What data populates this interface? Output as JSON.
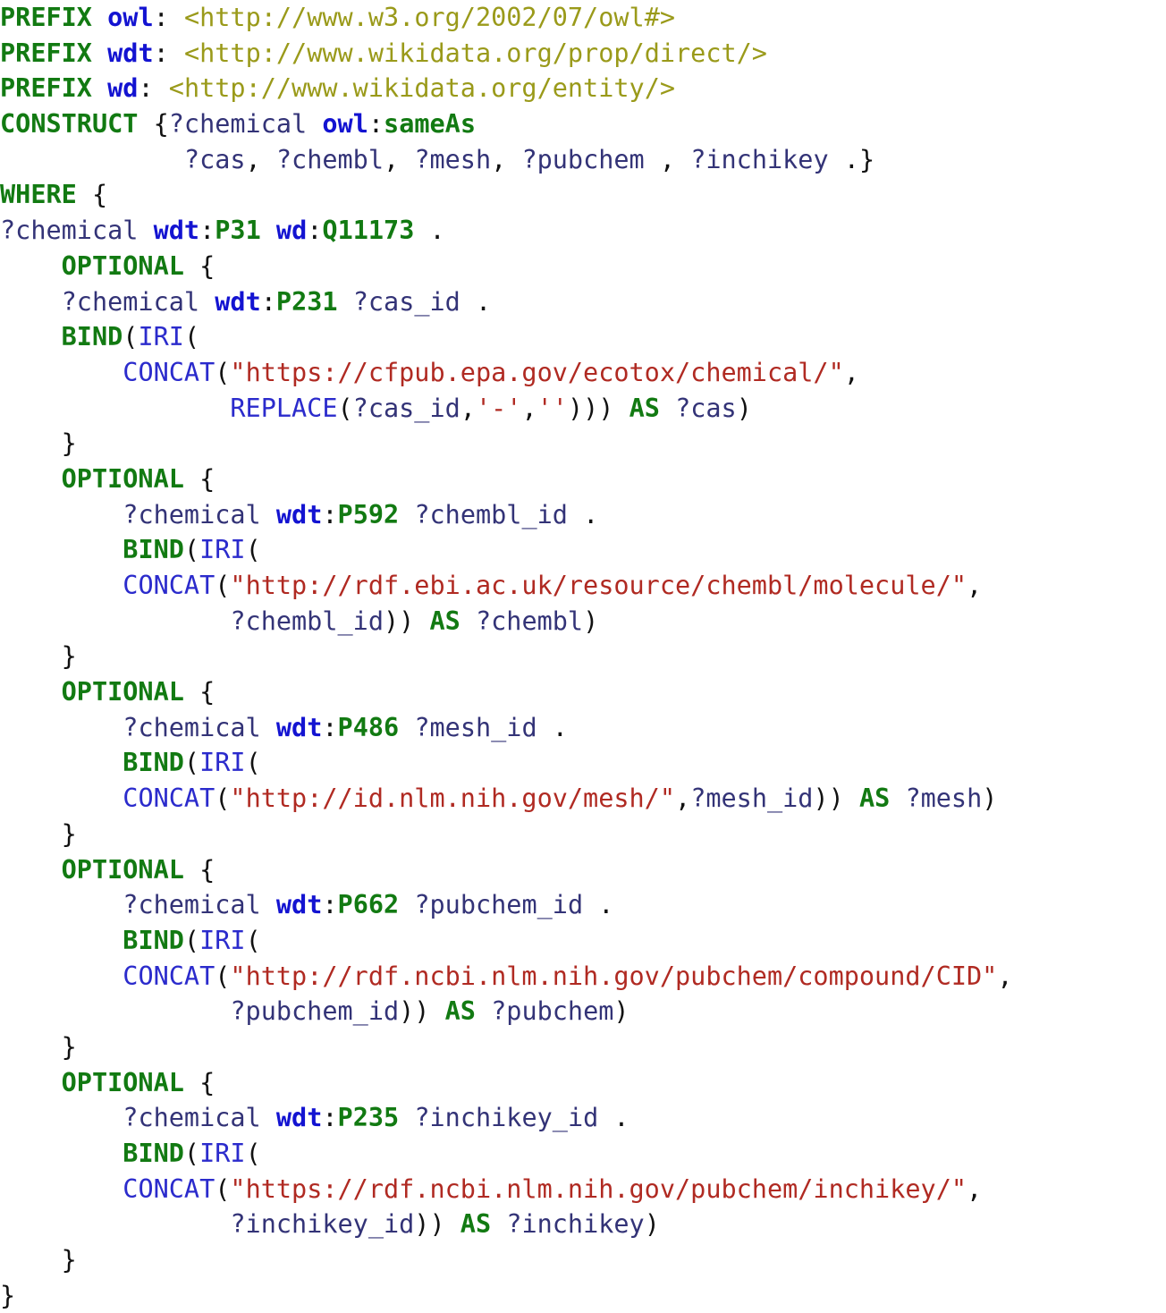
{
  "document": {
    "kind": "sparql-query-listing",
    "language": "SPARQL",
    "background_color": "#ffffff"
  },
  "palette": {
    "keyword": "#127a12",
    "prefix": "#1313d1",
    "localname": "#127a12",
    "iri": "#9a9a1a",
    "variable": "#333377",
    "function": "#2b2bcc",
    "string": "#b02a22",
    "punctuation": "#111111"
  },
  "code": {
    "lines": [
      {
        "id": "l1",
        "indent": 0,
        "tokens": [
          {
            "t": "PREFIX",
            "c": "kw"
          },
          {
            "t": " ",
            "c": "pun"
          },
          {
            "t": "owl",
            "c": "pfx"
          },
          {
            "t": ": ",
            "c": "pun"
          },
          {
            "t": "<http://www.w3.org/2002/07/owl#>",
            "c": "iri"
          }
        ]
      },
      {
        "id": "l2",
        "indent": 0,
        "tokens": [
          {
            "t": "PREFIX",
            "c": "kw"
          },
          {
            "t": " ",
            "c": "pun"
          },
          {
            "t": "wdt",
            "c": "pfx"
          },
          {
            "t": ": ",
            "c": "pun"
          },
          {
            "t": "<http://www.wikidata.org/prop/direct/>",
            "c": "iri"
          }
        ]
      },
      {
        "id": "l3",
        "indent": 0,
        "tokens": [
          {
            "t": "PREFIX",
            "c": "kw"
          },
          {
            "t": " ",
            "c": "pun"
          },
          {
            "t": "wd",
            "c": "pfx"
          },
          {
            "t": ": ",
            "c": "pun"
          },
          {
            "t": "<http://www.wikidata.org/entity/>",
            "c": "iri"
          }
        ]
      },
      {
        "id": "l4",
        "indent": 0,
        "tokens": [
          {
            "t": "CONSTRUCT",
            "c": "kw"
          },
          {
            "t": " {",
            "c": "pun"
          },
          {
            "t": "?chemical",
            "c": "var"
          },
          {
            "t": " ",
            "c": "pun"
          },
          {
            "t": "owl",
            "c": "pfx"
          },
          {
            "t": ":",
            "c": "pun"
          },
          {
            "t": "sameAs",
            "c": "loc"
          }
        ]
      },
      {
        "id": "l5",
        "indent": 12,
        "tokens": [
          {
            "t": "?cas",
            "c": "var"
          },
          {
            "t": ", ",
            "c": "pun"
          },
          {
            "t": "?chembl",
            "c": "var"
          },
          {
            "t": ", ",
            "c": "pun"
          },
          {
            "t": "?mesh",
            "c": "var"
          },
          {
            "t": ", ",
            "c": "pun"
          },
          {
            "t": "?pubchem",
            "c": "var"
          },
          {
            "t": " , ",
            "c": "pun"
          },
          {
            "t": "?inchikey",
            "c": "var"
          },
          {
            "t": " .}",
            "c": "pun"
          }
        ]
      },
      {
        "id": "l6",
        "indent": 0,
        "tokens": [
          {
            "t": "WHERE",
            "c": "kw"
          },
          {
            "t": " {",
            "c": "pun"
          }
        ]
      },
      {
        "id": "l7",
        "indent": 0,
        "tokens": [
          {
            "t": "?chemical",
            "c": "var"
          },
          {
            "t": " ",
            "c": "pun"
          },
          {
            "t": "wdt",
            "c": "pfx"
          },
          {
            "t": ":",
            "c": "pun"
          },
          {
            "t": "P31",
            "c": "loc"
          },
          {
            "t": " ",
            "c": "pun"
          },
          {
            "t": "wd",
            "c": "pfx"
          },
          {
            "t": ":",
            "c": "pun"
          },
          {
            "t": "Q11173",
            "c": "loc"
          },
          {
            "t": " .",
            "c": "pun"
          }
        ]
      },
      {
        "id": "l8",
        "indent": 4,
        "tokens": [
          {
            "t": "OPTIONAL",
            "c": "kw"
          },
          {
            "t": " {",
            "c": "pun"
          }
        ]
      },
      {
        "id": "l9",
        "indent": 4,
        "tokens": [
          {
            "t": "?chemical",
            "c": "var"
          },
          {
            "t": " ",
            "c": "pun"
          },
          {
            "t": "wdt",
            "c": "pfx"
          },
          {
            "t": ":",
            "c": "pun"
          },
          {
            "t": "P231",
            "c": "loc"
          },
          {
            "t": " ",
            "c": "pun"
          },
          {
            "t": "?cas_id",
            "c": "var"
          },
          {
            "t": " .",
            "c": "pun"
          }
        ]
      },
      {
        "id": "l10",
        "indent": 4,
        "tokens": [
          {
            "t": "BIND",
            "c": "kw"
          },
          {
            "t": "(",
            "c": "pun"
          },
          {
            "t": "IRI",
            "c": "fn"
          },
          {
            "t": "(",
            "c": "pun"
          }
        ]
      },
      {
        "id": "l11",
        "indent": 8,
        "tokens": [
          {
            "t": "CONCAT",
            "c": "fn"
          },
          {
            "t": "(",
            "c": "pun"
          },
          {
            "t": "\"https://cfpub.epa.gov/ecotox/chemical/\"",
            "c": "str"
          },
          {
            "t": ",",
            "c": "pun"
          }
        ]
      },
      {
        "id": "l12",
        "indent": 15,
        "tokens": [
          {
            "t": "REPLACE",
            "c": "fn"
          },
          {
            "t": "(",
            "c": "pun"
          },
          {
            "t": "?cas_id",
            "c": "var"
          },
          {
            "t": ",",
            "c": "pun"
          },
          {
            "t": "'-'",
            "c": "str"
          },
          {
            "t": ",",
            "c": "pun"
          },
          {
            "t": "''",
            "c": "str"
          },
          {
            "t": "))) ",
            "c": "pun"
          },
          {
            "t": "AS",
            "c": "kw"
          },
          {
            "t": " ",
            "c": "pun"
          },
          {
            "t": "?cas",
            "c": "var"
          },
          {
            "t": ")",
            "c": "pun"
          }
        ]
      },
      {
        "id": "l13",
        "indent": 4,
        "tokens": [
          {
            "t": "}",
            "c": "pun"
          }
        ]
      },
      {
        "id": "l14",
        "indent": 4,
        "tokens": [
          {
            "t": "OPTIONAL",
            "c": "kw"
          },
          {
            "t": " {",
            "c": "pun"
          }
        ]
      },
      {
        "id": "l15",
        "indent": 8,
        "tokens": [
          {
            "t": "?chemical",
            "c": "var"
          },
          {
            "t": " ",
            "c": "pun"
          },
          {
            "t": "wdt",
            "c": "pfx"
          },
          {
            "t": ":",
            "c": "pun"
          },
          {
            "t": "P592",
            "c": "loc"
          },
          {
            "t": " ",
            "c": "pun"
          },
          {
            "t": "?chembl_id",
            "c": "var"
          },
          {
            "t": " .",
            "c": "pun"
          }
        ]
      },
      {
        "id": "l16",
        "indent": 8,
        "tokens": [
          {
            "t": "BIND",
            "c": "kw"
          },
          {
            "t": "(",
            "c": "pun"
          },
          {
            "t": "IRI",
            "c": "fn"
          },
          {
            "t": "(",
            "c": "pun"
          }
        ]
      },
      {
        "id": "l17",
        "indent": 8,
        "tokens": [
          {
            "t": "CONCAT",
            "c": "fn"
          },
          {
            "t": "(",
            "c": "pun"
          },
          {
            "t": "\"http://rdf.ebi.ac.uk/resource/chembl/molecule/\"",
            "c": "str"
          },
          {
            "t": ",",
            "c": "pun"
          }
        ]
      },
      {
        "id": "l18",
        "indent": 15,
        "tokens": [
          {
            "t": "?chembl_id",
            "c": "var"
          },
          {
            "t": ")) ",
            "c": "pun"
          },
          {
            "t": "AS",
            "c": "kw"
          },
          {
            "t": " ",
            "c": "pun"
          },
          {
            "t": "?chembl",
            "c": "var"
          },
          {
            "t": ")",
            "c": "pun"
          }
        ]
      },
      {
        "id": "l19",
        "indent": 4,
        "tokens": [
          {
            "t": "}",
            "c": "pun"
          }
        ]
      },
      {
        "id": "l20",
        "indent": 4,
        "tokens": [
          {
            "t": "OPTIONAL",
            "c": "kw"
          },
          {
            "t": " {",
            "c": "pun"
          }
        ]
      },
      {
        "id": "l21",
        "indent": 8,
        "tokens": [
          {
            "t": "?chemical",
            "c": "var"
          },
          {
            "t": " ",
            "c": "pun"
          },
          {
            "t": "wdt",
            "c": "pfx"
          },
          {
            "t": ":",
            "c": "pun"
          },
          {
            "t": "P486",
            "c": "loc"
          },
          {
            "t": " ",
            "c": "pun"
          },
          {
            "t": "?mesh_id",
            "c": "var"
          },
          {
            "t": " .",
            "c": "pun"
          }
        ]
      },
      {
        "id": "l22",
        "indent": 8,
        "tokens": [
          {
            "t": "BIND",
            "c": "kw"
          },
          {
            "t": "(",
            "c": "pun"
          },
          {
            "t": "IRI",
            "c": "fn"
          },
          {
            "t": "(",
            "c": "pun"
          }
        ]
      },
      {
        "id": "l23",
        "indent": 8,
        "tokens": [
          {
            "t": "CONCAT",
            "c": "fn"
          },
          {
            "t": "(",
            "c": "pun"
          },
          {
            "t": "\"http://id.nlm.nih.gov/mesh/\"",
            "c": "str"
          },
          {
            "t": ",",
            "c": "pun"
          },
          {
            "t": "?mesh_id",
            "c": "var"
          },
          {
            "t": ")) ",
            "c": "pun"
          },
          {
            "t": "AS",
            "c": "kw"
          },
          {
            "t": " ",
            "c": "pun"
          },
          {
            "t": "?mesh",
            "c": "var"
          },
          {
            "t": ")",
            "c": "pun"
          }
        ]
      },
      {
        "id": "l24",
        "indent": 4,
        "tokens": [
          {
            "t": "}",
            "c": "pun"
          }
        ]
      },
      {
        "id": "l25",
        "indent": 4,
        "tokens": [
          {
            "t": "OPTIONAL",
            "c": "kw"
          },
          {
            "t": " {",
            "c": "pun"
          }
        ]
      },
      {
        "id": "l26",
        "indent": 8,
        "tokens": [
          {
            "t": "?chemical",
            "c": "var"
          },
          {
            "t": " ",
            "c": "pun"
          },
          {
            "t": "wdt",
            "c": "pfx"
          },
          {
            "t": ":",
            "c": "pun"
          },
          {
            "t": "P662",
            "c": "loc"
          },
          {
            "t": " ",
            "c": "pun"
          },
          {
            "t": "?pubchem_id",
            "c": "var"
          },
          {
            "t": " .",
            "c": "pun"
          }
        ]
      },
      {
        "id": "l27",
        "indent": 8,
        "tokens": [
          {
            "t": "BIND",
            "c": "kw"
          },
          {
            "t": "(",
            "c": "pun"
          },
          {
            "t": "IRI",
            "c": "fn"
          },
          {
            "t": "(",
            "c": "pun"
          }
        ]
      },
      {
        "id": "l28",
        "indent": 8,
        "tokens": [
          {
            "t": "CONCAT",
            "c": "fn"
          },
          {
            "t": "(",
            "c": "pun"
          },
          {
            "t": "\"http://rdf.ncbi.nlm.nih.gov/pubchem/compound/CID\"",
            "c": "str"
          },
          {
            "t": ",",
            "c": "pun"
          }
        ]
      },
      {
        "id": "l29",
        "indent": 15,
        "tokens": [
          {
            "t": "?pubchem_id",
            "c": "var"
          },
          {
            "t": ")) ",
            "c": "pun"
          },
          {
            "t": "AS",
            "c": "kw"
          },
          {
            "t": " ",
            "c": "pun"
          },
          {
            "t": "?pubchem",
            "c": "var"
          },
          {
            "t": ")",
            "c": "pun"
          }
        ]
      },
      {
        "id": "l30",
        "indent": 4,
        "tokens": [
          {
            "t": "}",
            "c": "pun"
          }
        ]
      },
      {
        "id": "l31",
        "indent": 4,
        "tokens": [
          {
            "t": "OPTIONAL",
            "c": "kw"
          },
          {
            "t": " {",
            "c": "pun"
          }
        ]
      },
      {
        "id": "l32",
        "indent": 8,
        "tokens": [
          {
            "t": "?chemical",
            "c": "var"
          },
          {
            "t": " ",
            "c": "pun"
          },
          {
            "t": "wdt",
            "c": "pfx"
          },
          {
            "t": ":",
            "c": "pun"
          },
          {
            "t": "P235",
            "c": "loc"
          },
          {
            "t": " ",
            "c": "pun"
          },
          {
            "t": "?inchikey_id",
            "c": "var"
          },
          {
            "t": " .",
            "c": "pun"
          }
        ]
      },
      {
        "id": "l33",
        "indent": 8,
        "tokens": [
          {
            "t": "BIND",
            "c": "kw"
          },
          {
            "t": "(",
            "c": "pun"
          },
          {
            "t": "IRI",
            "c": "fn"
          },
          {
            "t": "(",
            "c": "pun"
          }
        ]
      },
      {
        "id": "l34",
        "indent": 8,
        "tokens": [
          {
            "t": "CONCAT",
            "c": "fn"
          },
          {
            "t": "(",
            "c": "pun"
          },
          {
            "t": "\"https://rdf.ncbi.nlm.nih.gov/pubchem/inchikey/\"",
            "c": "str"
          },
          {
            "t": ",",
            "c": "pun"
          }
        ]
      },
      {
        "id": "l35",
        "indent": 15,
        "tokens": [
          {
            "t": "?inchikey_id",
            "c": "var"
          },
          {
            "t": ")) ",
            "c": "pun"
          },
          {
            "t": "AS",
            "c": "kw"
          },
          {
            "t": " ",
            "c": "pun"
          },
          {
            "t": "?inchikey",
            "c": "var"
          },
          {
            "t": ")",
            "c": "pun"
          }
        ]
      },
      {
        "id": "l36",
        "indent": 4,
        "tokens": [
          {
            "t": "}",
            "c": "pun"
          }
        ]
      },
      {
        "id": "l37",
        "indent": 0,
        "tokens": [
          {
            "t": "}",
            "c": "pun"
          }
        ]
      }
    ]
  }
}
